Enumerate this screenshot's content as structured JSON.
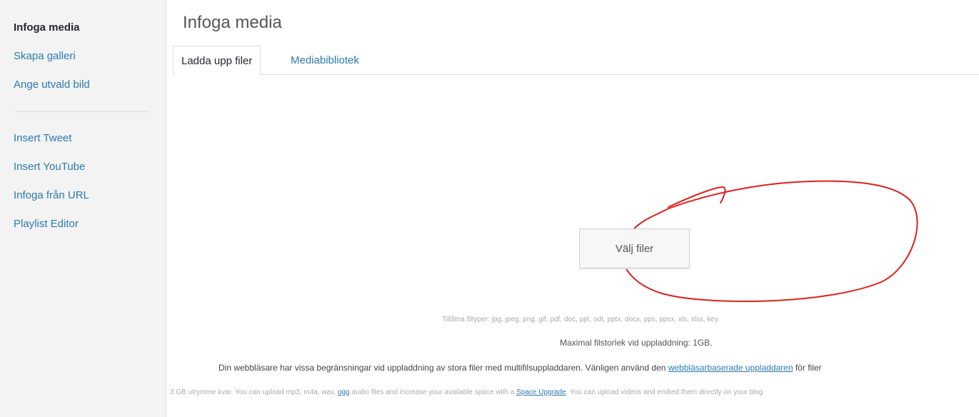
{
  "sidebar": {
    "items": [
      {
        "label": "Infoga media"
      },
      {
        "label": "Skapa galleri"
      },
      {
        "label": "Ange utvald bild"
      }
    ],
    "items2": [
      {
        "label": "Insert Tweet"
      },
      {
        "label": "Insert YouTube"
      },
      {
        "label": "Infoga från URL"
      },
      {
        "label": "Playlist Editor"
      }
    ]
  },
  "main": {
    "title": "Infoga media",
    "tabs": [
      {
        "label": "Ladda upp filer"
      },
      {
        "label": "Mediabibliotek"
      }
    ],
    "select_button": "Välj filer",
    "allowed_types": "Tillåtna filtyper: jpg, jpeg, png, gif, pdf, doc, ppt, odt, pptx, docx, pps, ppsx, xls, xlsx, key.",
    "max_size": "Maximal filstorlek vid uppladdning: 1GB.",
    "browser_note_before": "Din webbläsare har vissa begränsningar vid uppladdning av stora filer med multifilsuppladdaren. Vänligen använd den ",
    "browser_note_link": "webbläsarbaserade uppladdaren",
    "browser_note_after": " för filer",
    "space_before": "3 GB utrymme kvar. You can upload mp3, m4a, wav, ",
    "space_ogg": "ogg",
    "space_middle": " audio files and increase your available space with a ",
    "space_link": "Space Upgrade",
    "space_after": ". You can upload videos and embed them directly on your blog"
  },
  "colors": {
    "link": "#2b7bb0",
    "annotation": "#e0201c"
  }
}
